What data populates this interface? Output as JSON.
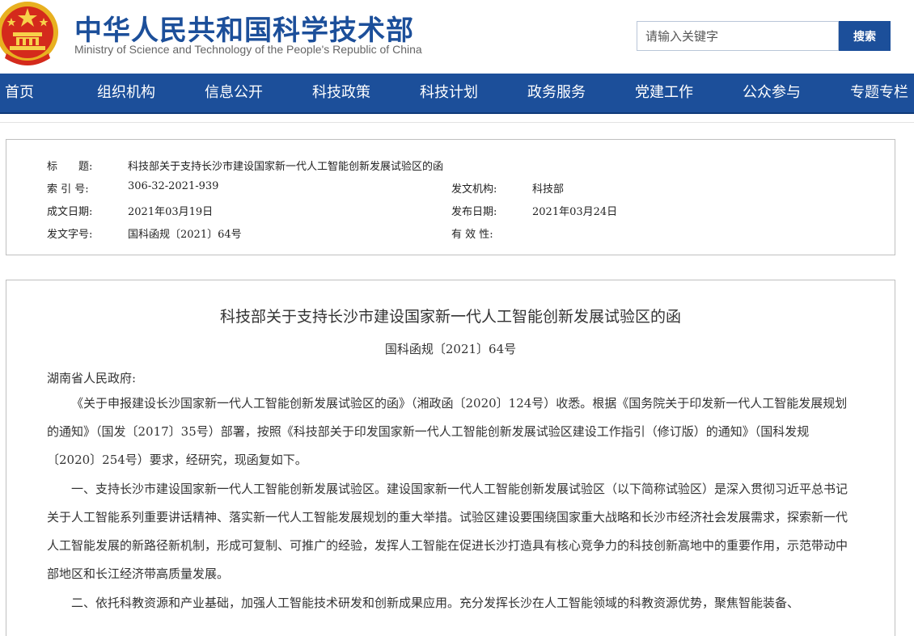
{
  "header": {
    "title": "中华人民共和国科学技术部",
    "subtitle": "Ministry of Science and Technology of the People's Republic of China",
    "search_placeholder": "请输入关键字",
    "search_button": "搜索"
  },
  "nav": {
    "items": [
      "首页",
      "组织机构",
      "信息公开",
      "科技政策",
      "科技计划",
      "政务服务",
      "党建工作",
      "公众参与",
      "专题专栏"
    ]
  },
  "meta": {
    "title_label": "标　　题:",
    "title_value": "科技部关于支持长沙市建设国家新一代人工智能创新发展试验区的函",
    "index_label": "索 引 号:",
    "index_value": "306-32-2021-939",
    "issuer_label": "发文机构:",
    "issuer_value": "科技部",
    "created_label": "成文日期:",
    "created_value": "2021年03月19日",
    "published_label": "发布日期:",
    "published_value": "2021年03月24日",
    "docno_label": "发文字号:",
    "docno_value": "国科函规〔2021〕64号",
    "validity_label": "有 效 性:"
  },
  "document": {
    "title": "科技部关于支持长沙市建设国家新一代人工智能创新发展试验区的函",
    "number": "国科函规〔2021〕64号",
    "addressee": "湖南省人民政府:",
    "paragraphs": [
      "《关于申报建设长沙国家新一代人工智能创新发展试验区的函》（湘政函〔2020〕124号）收悉。根据《国务院关于印发新一代人工智能发展规划的通知》（国发〔2017〕35号）部署，按照《科技部关于印发国家新一代人工智能创新发展试验区建设工作指引（修订版）的通知》（国科发规〔2020〕254号）要求，经研究，现函复如下。",
      "一、支持长沙市建设国家新一代人工智能创新发展试验区。建设国家新一代人工智能创新发展试验区（以下简称试验区）是深入贯彻习近平总书记关于人工智能系列重要讲话精神、落实新一代人工智能发展规划的重大举措。试验区建设要围绕国家重大战略和长沙市经济社会发展需求，探索新一代人工智能发展的新路径新机制，形成可复制、可推广的经验，发挥人工智能在促进长沙打造具有核心竞争力的科技创新高地中的重要作用，示范带动中部地区和长江经济带高质量发展。",
      "二、依托科教资源和产业基础，加强人工智能技术研发和创新成果应用。充分发挥长沙在人工智能领域的科教资源优势，聚焦智能装备、"
    ]
  }
}
